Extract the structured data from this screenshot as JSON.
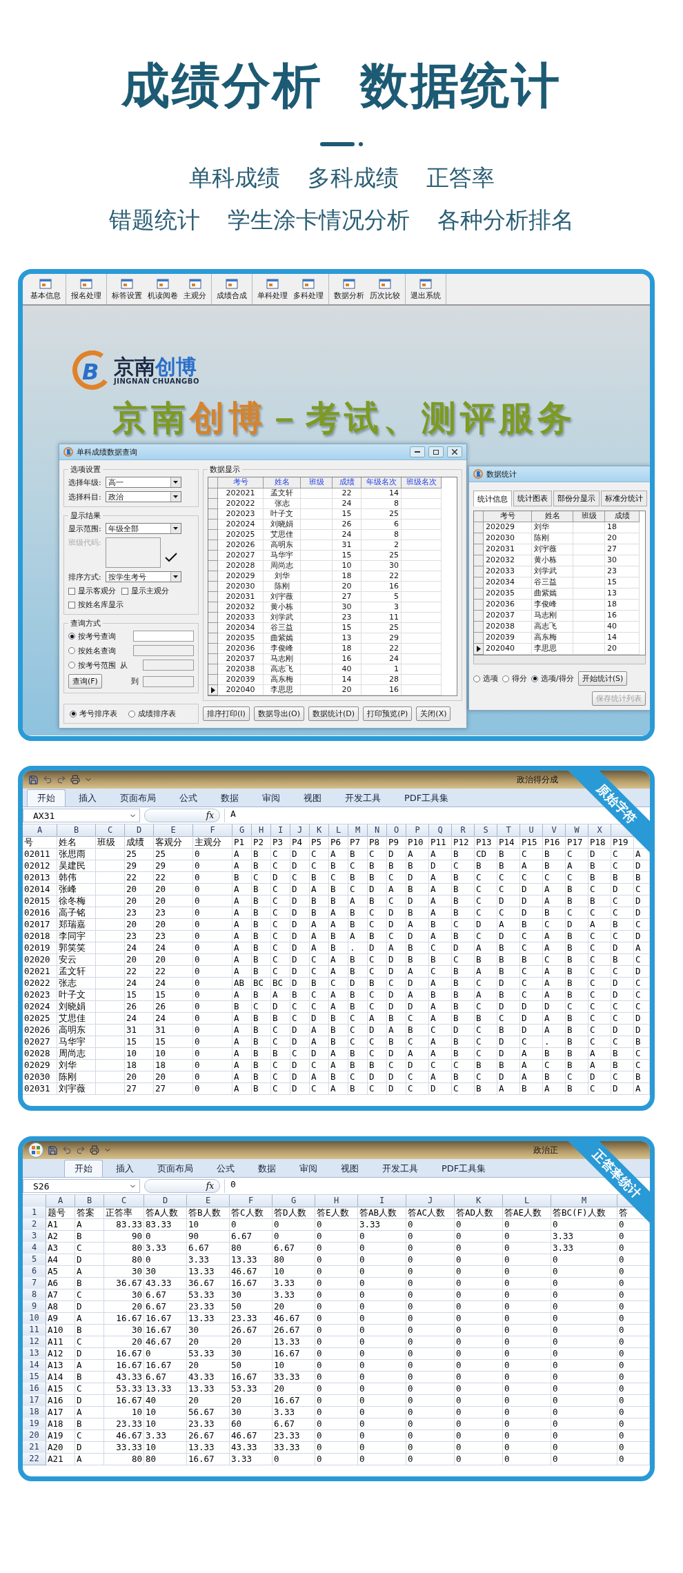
{
  "header": {
    "title": "成绩分析  数据统计",
    "features": [
      [
        "单科成绩",
        "多科成绩",
        "正答率"
      ],
      [
        "错题统计",
        "学生涂卡情况分析",
        "各种分析排名"
      ]
    ]
  },
  "app": {
    "toolbar": [
      [
        "基本信息"
      ],
      [
        "报名处理"
      ],
      [
        "标答设置",
        "机读阅卷",
        "主观分"
      ],
      [
        "成绩合成"
      ],
      [
        "单科处理",
        "多科处理"
      ],
      [
        "数据分析",
        "历次比较"
      ],
      [
        "退出系统"
      ]
    ],
    "logo": {
      "mark": "B",
      "name_a": "京南",
      "name_b": "创博",
      "subtitle": "JINGNAN CHUANGBO"
    },
    "banner": [
      {
        "text": "京南",
        "color": "#7d9a22"
      },
      {
        "text": "创博",
        "color": "#d7832a"
      },
      {
        "text": "－考试、测评服务",
        "color": "#7d9a22"
      }
    ],
    "query_dialog": {
      "title": "单科成绩数据查询",
      "options": {
        "legend": "选项设置",
        "grade": {
          "label": "选择年级:",
          "value": "高一"
        },
        "subject": {
          "label": "选择科目:",
          "value": "政治"
        }
      },
      "display": {
        "legend": "显示结果",
        "range": {
          "label": "显示范围:",
          "value": "年级全部"
        },
        "class_code": {
          "label": "班级代码:",
          "disabled": true
        },
        "sort": {
          "label": "排序方式:",
          "value": "按学生考号"
        },
        "checkboxes": [
          {
            "label": "显示客观分",
            "checked": false
          },
          {
            "label": "显示主观分",
            "checked": false
          },
          {
            "label": "按姓名库显示",
            "checked": false
          }
        ]
      },
      "query": {
        "legend": "查询方式",
        "modes": [
          {
            "label": "按考号查询",
            "selected": true
          },
          {
            "label": "按姓名查询",
            "selected": false
          },
          {
            "label": "按考号范围",
            "selected": false
          }
        ],
        "from_label": "从",
        "to_label": "到",
        "button": "查询(F)"
      },
      "sort_tables": [
        {
          "label": "考号排序表",
          "selected": true
        },
        {
          "label": "成绩排序表",
          "selected": false
        }
      ],
      "buttons": [
        "排序打印(I)",
        "数据导出(O)",
        "数据统计(D)",
        "打印预览(P)",
        "关闭(X)"
      ],
      "grid": {
        "legend": "数据显示",
        "columns": [
          "考号",
          "姓名",
          "班级",
          "成绩",
          "年级名次",
          "班级名次"
        ],
        "rows": [
          {
            "cells": [
              "202021",
              "孟文轩",
              "",
              "22",
              "14",
              ""
            ],
            "current": false
          },
          {
            "cells": [
              "202022",
              "张志",
              "",
              "24",
              "8",
              ""
            ],
            "current": false
          },
          {
            "cells": [
              "202023",
              "叶子文",
              "",
              "15",
              "25",
              ""
            ],
            "current": false
          },
          {
            "cells": [
              "202024",
              "刘晓娟",
              "",
              "26",
              "6",
              ""
            ],
            "current": false
          },
          {
            "cells": [
              "202025",
              "艾思佳",
              "",
              "24",
              "8",
              ""
            ],
            "current": false
          },
          {
            "cells": [
              "202026",
              "高明东",
              "",
              "31",
              "2",
              ""
            ],
            "current": false
          },
          {
            "cells": [
              "202027",
              "马华宇",
              "",
              "15",
              "25",
              ""
            ],
            "current": false
          },
          {
            "cells": [
              "202028",
              "周尚志",
              "",
              "10",
              "30",
              ""
            ],
            "current": false
          },
          {
            "cells": [
              "202029",
              "刘华",
              "",
              "18",
              "22",
              ""
            ],
            "current": false
          },
          {
            "cells": [
              "202030",
              "陈刚",
              "",
              "20",
              "16",
              ""
            ],
            "current": false
          },
          {
            "cells": [
              "202031",
              "刘宇薇",
              "",
              "27",
              "5",
              ""
            ],
            "current": false
          },
          {
            "cells": [
              "202032",
              "黄小栋",
              "",
              "30",
              "3",
              ""
            ],
            "current": false
          },
          {
            "cells": [
              "202033",
              "刘学武",
              "",
              "23",
              "11",
              ""
            ],
            "current": false
          },
          {
            "cells": [
              "202034",
              "谷三益",
              "",
              "15",
              "25",
              ""
            ],
            "current": false
          },
          {
            "cells": [
              "202035",
              "曲紫嫣",
              "",
              "13",
              "29",
              ""
            ],
            "current": false
          },
          {
            "cells": [
              "202036",
              "李俊峰",
              "",
              "18",
              "22",
              ""
            ],
            "current": false
          },
          {
            "cells": [
              "202037",
              "马志刚",
              "",
              "16",
              "24",
              ""
            ],
            "current": false
          },
          {
            "cells": [
              "202038",
              "高志飞",
              "",
              "40",
              "1",
              ""
            ],
            "current": false
          },
          {
            "cells": [
              "202039",
              "高东梅",
              "",
              "14",
              "28",
              ""
            ],
            "current": false
          },
          {
            "cells": [
              "202040",
              "李思思",
              "",
              "20",
              "16",
              ""
            ],
            "current": true
          }
        ]
      }
    },
    "stats_dialog": {
      "title": "数据统计",
      "tabs": [
        {
          "label": "统计信息",
          "selected": true
        },
        {
          "label": "统计图表",
          "selected": false
        },
        {
          "label": "部份分显示",
          "selected": false
        },
        {
          "label": "标准分统计",
          "selected": false
        }
      ],
      "grid": {
        "columns": [
          "考号",
          "姓名",
          "班级",
          "成绩"
        ],
        "rows": [
          {
            "cells": [
              "202029",
              "刘华",
              "",
              "18"
            ],
            "current": false
          },
          {
            "cells": [
              "202030",
              "陈刚",
              "",
              "20"
            ],
            "current": false
          },
          {
            "cells": [
              "202031",
              "刘宇薇",
              "",
              "27"
            ],
            "current": false
          },
          {
            "cells": [
              "202032",
              "黄小栋",
              "",
              "30"
            ],
            "current": false
          },
          {
            "cells": [
              "202033",
              "刘学武",
              "",
              "23"
            ],
            "current": false
          },
          {
            "cells": [
              "202034",
              "谷三益",
              "",
              "15"
            ],
            "current": false
          },
          {
            "cells": [
              "202035",
              "曲紫嫣",
              "",
              "13"
            ],
            "current": false
          },
          {
            "cells": [
              "202036",
              "李俊峰",
              "",
              "18"
            ],
            "current": false
          },
          {
            "cells": [
              "202037",
              "马志刚",
              "",
              "16"
            ],
            "current": false
          },
          {
            "cells": [
              "202038",
              "高志飞",
              "",
              "40"
            ],
            "current": false
          },
          {
            "cells": [
              "202039",
              "高东梅",
              "",
              "14"
            ],
            "current": false
          },
          {
            "cells": [
              "202040",
              "李思思",
              "",
              "20"
            ],
            "current": true
          }
        ]
      },
      "modes": [
        {
          "label": "选项",
          "selected": false
        },
        {
          "label": "得分",
          "selected": false
        },
        {
          "label": "选项/得分",
          "selected": true
        }
      ],
      "start_button": "开始统计(S)",
      "save_button": {
        "label": "保存统计列表",
        "disabled": true
      }
    }
  },
  "sheets": [
    {
      "ribbon": "原始字符",
      "window_title": "政治得分成",
      "office_button": false,
      "tabs": [
        {
          "label": "开始",
          "selected": true
        },
        {
          "label": "插入",
          "selected": false
        },
        {
          "label": "页面布局",
          "selected": false
        },
        {
          "label": "公式",
          "selected": false
        },
        {
          "label": "数据",
          "selected": false
        },
        {
          "label": "审阅",
          "selected": false
        },
        {
          "label": "视图",
          "selected": false
        },
        {
          "label": "开发工具",
          "selected": false
        },
        {
          "label": "PDF工具集",
          "selected": false
        }
      ],
      "name_box": "AX31",
      "function_label": "fx",
      "formula": "A",
      "column_letters": [
        "A",
        "B",
        "C",
        "D",
        "E",
        "F",
        "G",
        "H",
        "I",
        "J",
        "K",
        "L",
        "M",
        "N",
        "O",
        "P",
        "Q",
        "R",
        "S",
        "T",
        "U",
        "V",
        "W",
        "X"
      ],
      "rows": [
        [
          "号",
          "姓名",
          "班级",
          "成绩",
          "客观分",
          "主观分",
          "P1",
          "P2",
          "P3",
          "P4",
          "P5",
          "P6",
          "P7",
          "P8",
          "P9",
          "P10",
          "P11",
          "P12",
          "P13",
          "P14",
          "P15",
          "P16",
          "P17",
          "P18",
          "P19",
          ""
        ],
        [
          "02011",
          "张思雨",
          "",
          "25",
          "25",
          "0",
          "A",
          "B",
          "C",
          "D",
          "C",
          "A",
          "B",
          "C",
          "D",
          "A",
          "A",
          "B",
          "CD",
          "B",
          "C",
          "B",
          "C",
          "D",
          "C",
          "A"
        ],
        [
          "02012",
          "吴建民",
          "",
          "29",
          "29",
          "0",
          "A",
          "B",
          "C",
          "D",
          "C",
          "B",
          "C",
          "B",
          "B",
          "B",
          "D",
          "C",
          "B",
          "B",
          "A",
          "B",
          "A",
          "B",
          "C",
          "D"
        ],
        [
          "02013",
          "韩伟",
          "",
          "22",
          "22",
          "0",
          "B",
          "C",
          "D",
          "C",
          "B",
          "C",
          "B",
          "B",
          "C",
          "D",
          "A",
          "B",
          "C",
          "C",
          "C",
          "C",
          "C",
          "B",
          "B",
          "B"
        ],
        [
          "02014",
          "张峰",
          "",
          "20",
          "20",
          "0",
          "A",
          "B",
          "C",
          "D",
          "A",
          "B",
          "C",
          "D",
          "A",
          "B",
          "A",
          "B",
          "C",
          "C",
          "D",
          "A",
          "B",
          "C",
          "D",
          "C"
        ],
        [
          "02015",
          "徐冬梅",
          "",
          "20",
          "20",
          "0",
          "A",
          "B",
          "C",
          "D",
          "B",
          "B",
          "A",
          "B",
          "C",
          "D",
          "A",
          "B",
          "C",
          "D",
          "D",
          "A",
          "B",
          "B",
          "C",
          "D"
        ],
        [
          "02016",
          "高子铭",
          "",
          "23",
          "23",
          "0",
          "A",
          "B",
          "C",
          "D",
          "B",
          "A",
          "B",
          "C",
          "D",
          "B",
          "A",
          "B",
          "C",
          "C",
          "D",
          "B",
          "C",
          "C",
          "C",
          "D"
        ],
        [
          "02017",
          "郑瑞嘉",
          "",
          "20",
          "20",
          "0",
          "A",
          "B",
          "C",
          "D",
          "A",
          "A",
          "B",
          "C",
          "D",
          "A",
          "B",
          "C",
          "D",
          "A",
          "B",
          "C",
          "D",
          "A",
          "B",
          "C"
        ],
        [
          "02018",
          "李同宇",
          "",
          "23",
          "23",
          "0",
          "A",
          "B",
          "C",
          "D",
          "A",
          "B",
          "A",
          "B",
          "C",
          "D",
          "A",
          "B",
          "C",
          "D",
          "C",
          "A",
          "B",
          "C",
          "C",
          "D"
        ],
        [
          "02019",
          "郭笑笑",
          "",
          "24",
          "24",
          "0",
          "A",
          "B",
          "C",
          "D",
          "A",
          "B",
          ".",
          "D",
          "A",
          "B",
          "C",
          "D",
          "A",
          "B",
          "C",
          "A",
          "B",
          "C",
          "D",
          "A"
        ],
        [
          "02020",
          "安云",
          "",
          "20",
          "20",
          "0",
          "A",
          "B",
          "C",
          "D",
          "C",
          "A",
          "B",
          "C",
          "D",
          "B",
          "B",
          "C",
          "B",
          "B",
          "B",
          "C",
          "B",
          "C",
          "B",
          "C"
        ],
        [
          "02021",
          "孟文轩",
          "",
          "22",
          "22",
          "0",
          "A",
          "B",
          "C",
          "D",
          "C",
          "A",
          "B",
          "C",
          "D",
          "A",
          "C",
          "B",
          "A",
          "B",
          "C",
          "A",
          "B",
          "C",
          "C",
          "D"
        ],
        [
          "02022",
          "张志",
          "",
          "24",
          "24",
          "0",
          "AB",
          "BC",
          "BC",
          "D",
          "B",
          "C",
          "D",
          "B",
          "C",
          "D",
          "A",
          "B",
          "C",
          "D",
          "C",
          "A",
          "B",
          "C",
          "D",
          "C"
        ],
        [
          "02023",
          "叶子文",
          "",
          "15",
          "15",
          "0",
          "A",
          "B",
          "A",
          "B",
          "C",
          "A",
          "B",
          "C",
          "D",
          "A",
          "B",
          "B",
          "A",
          "B",
          "C",
          "A",
          "B",
          "C",
          "D",
          "C"
        ],
        [
          "02024",
          "刘晓娟",
          "",
          "26",
          "26",
          "0",
          "B",
          "C",
          "D",
          "C",
          "C",
          "A",
          "B",
          "C",
          "D",
          "D",
          "A",
          "B",
          "C",
          "D",
          "D",
          "D",
          "C",
          "C",
          "C",
          "C"
        ],
        [
          "02025",
          "艾思佳",
          "",
          "24",
          "24",
          "0",
          "A",
          "B",
          "B",
          "C",
          "D",
          "B",
          "C",
          "A",
          "B",
          "C",
          "A",
          "B",
          "B",
          "C",
          "D",
          "A",
          "B",
          "C",
          "C",
          "D"
        ],
        [
          "02026",
          "高明东",
          "",
          "31",
          "31",
          "0",
          "A",
          "B",
          "C",
          "D",
          "A",
          "B",
          "C",
          "D",
          "A",
          "B",
          "C",
          "D",
          "C",
          "B",
          "D",
          "A",
          "B",
          "C",
          "D",
          "D"
        ],
        [
          "02027",
          "马华宇",
          "",
          "15",
          "15",
          "0",
          "A",
          "B",
          "C",
          "D",
          "A",
          "B",
          "C",
          "C",
          "B",
          "C",
          "A",
          "B",
          "C",
          "D",
          "C",
          ".",
          "B",
          "C",
          "C",
          "B"
        ],
        [
          "02028",
          "周尚志",
          "",
          "10",
          "10",
          "0",
          "A",
          "B",
          "B",
          "C",
          "D",
          "A",
          "B",
          "C",
          "D",
          "A",
          "A",
          "B",
          "C",
          "D",
          "A",
          "B",
          "B",
          "A",
          "B",
          "C"
        ],
        [
          "02029",
          "刘华",
          "",
          "18",
          "18",
          "0",
          "A",
          "B",
          "C",
          "D",
          "C",
          "A",
          "B",
          "B",
          "C",
          "D",
          "C",
          "C",
          "B",
          "B",
          "A",
          "C",
          "B",
          "A",
          "B",
          "C"
        ],
        [
          "02030",
          "陈刚",
          "",
          "20",
          "20",
          "0",
          "A",
          "B",
          "C",
          "D",
          "A",
          "B",
          "C",
          "D",
          "D",
          "C",
          "A",
          "B",
          "C",
          "D",
          "A",
          "B",
          "C",
          "D",
          "C",
          "B"
        ],
        [
          "02031",
          "刘宇薇",
          "",
          "27",
          "27",
          "0",
          "A",
          "B",
          "C",
          "D",
          "C",
          "A",
          "B",
          "C",
          "D",
          "C",
          "D",
          "C",
          "B",
          "A",
          "B",
          "A",
          "B",
          "C",
          "D",
          "A"
        ]
      ]
    },
    {
      "ribbon": "正答率统计",
      "window_title": "政治正",
      "office_button": true,
      "tabs": [
        {
          "label": "开始",
          "selected": true
        },
        {
          "label": "插入",
          "selected": false
        },
        {
          "label": "页面布局",
          "selected": false
        },
        {
          "label": "公式",
          "selected": false
        },
        {
          "label": "数据",
          "selected": false
        },
        {
          "label": "审阅",
          "selected": false
        },
        {
          "label": "视图",
          "selected": false
        },
        {
          "label": "开发工具",
          "selected": false
        },
        {
          "label": "PDF工具集",
          "selected": false
        }
      ],
      "name_box": "S26",
      "function_label": "fx",
      "formula": "0",
      "column_letters": [
        "A",
        "B",
        "C",
        "D",
        "E",
        "F",
        "G",
        "H",
        "I",
        "J",
        "K",
        "L",
        "M"
      ],
      "row_numbers": [
        "1",
        "2",
        "3",
        "4",
        "5",
        "6",
        "7",
        "8",
        "9",
        "10",
        "11",
        "12",
        "13",
        "14",
        "15",
        "16",
        "17",
        "18",
        "19",
        "20",
        "21",
        "22"
      ],
      "rows": [
        [
          "题号",
          "答案",
          "正答率",
          "答A人数",
          "答B人数",
          "答C人数",
          "答D人数",
          "答E人数",
          "答AB人数",
          "答AC人数",
          "答AD人数",
          "答AE人数",
          "答BC(F)人数",
          "答"
        ],
        [
          "A1",
          "A",
          "83.33",
          "83.33",
          "10",
          "0",
          "0",
          "0",
          "3.33",
          "0",
          "0",
          "0",
          "0",
          "0"
        ],
        [
          "A2",
          "B",
          "90",
          "0",
          "90",
          "6.67",
          "0",
          "0",
          "0",
          "0",
          "0",
          "0",
          "3.33",
          "0"
        ],
        [
          "A3",
          "C",
          "80",
          "3.33",
          "6.67",
          "80",
          "6.67",
          "0",
          "0",
          "0",
          "0",
          "0",
          "3.33",
          "0"
        ],
        [
          "A4",
          "D",
          "80",
          "0",
          "3.33",
          "13.33",
          "80",
          "0",
          "0",
          "0",
          "0",
          "0",
          "0",
          "0"
        ],
        [
          "A5",
          "A",
          "30",
          "30",
          "13.33",
          "46.67",
          "10",
          "0",
          "0",
          "0",
          "0",
          "0",
          "0",
          "0"
        ],
        [
          "A6",
          "B",
          "36.67",
          "43.33",
          "36.67",
          "16.67",
          "3.33",
          "0",
          "0",
          "0",
          "0",
          "0",
          "0",
          "0"
        ],
        [
          "A7",
          "C",
          "30",
          "6.67",
          "53.33",
          "30",
          "3.33",
          "0",
          "0",
          "0",
          "0",
          "0",
          "0",
          "0"
        ],
        [
          "A8",
          "D",
          "20",
          "6.67",
          "23.33",
          "50",
          "20",
          "0",
          "0",
          "0",
          "0",
          "0",
          "0",
          "0"
        ],
        [
          "A9",
          "A",
          "16.67",
          "16.67",
          "13.33",
          "23.33",
          "46.67",
          "0",
          "0",
          "0",
          "0",
          "0",
          "0",
          "0"
        ],
        [
          "A10",
          "B",
          "30",
          "16.67",
          "30",
          "26.67",
          "26.67",
          "0",
          "0",
          "0",
          "0",
          "0",
          "0",
          "0"
        ],
        [
          "A11",
          "C",
          "20",
          "46.67",
          "20",
          "20",
          "13.33",
          "0",
          "0",
          "0",
          "0",
          "0",
          "0",
          "0"
        ],
        [
          "A12",
          "D",
          "16.67",
          "0",
          "53.33",
          "30",
          "16.67",
          "0",
          "0",
          "0",
          "0",
          "0",
          "0",
          "0"
        ],
        [
          "A13",
          "A",
          "16.67",
          "16.67",
          "20",
          "50",
          "10",
          "0",
          "0",
          "0",
          "0",
          "0",
          "0",
          "0"
        ],
        [
          "A14",
          "B",
          "43.33",
          "6.67",
          "43.33",
          "16.67",
          "33.33",
          "0",
          "0",
          "0",
          "0",
          "0",
          "0",
          "0"
        ],
        [
          "A15",
          "C",
          "53.33",
          "13.33",
          "13.33",
          "53.33",
          "20",
          "0",
          "0",
          "0",
          "0",
          "0",
          "0",
          "0"
        ],
        [
          "A16",
          "D",
          "16.67",
          "40",
          "20",
          "20",
          "16.67",
          "0",
          "0",
          "0",
          "0",
          "0",
          "0",
          "0"
        ],
        [
          "A17",
          "A",
          "10",
          "10",
          "56.67",
          "30",
          "3.33",
          "0",
          "0",
          "0",
          "0",
          "0",
          "0",
          "0"
        ],
        [
          "A18",
          "B",
          "23.33",
          "10",
          "23.33",
          "60",
          "6.67",
          "0",
          "0",
          "0",
          "0",
          "0",
          "0",
          "0"
        ],
        [
          "A19",
          "C",
          "46.67",
          "3.33",
          "26.67",
          "46.67",
          "23.33",
          "0",
          "0",
          "0",
          "0",
          "0",
          "0",
          "0"
        ],
        [
          "A20",
          "D",
          "33.33",
          "10",
          "13.33",
          "43.33",
          "33.33",
          "0",
          "0",
          "0",
          "0",
          "0",
          "0",
          "0"
        ],
        [
          "A21",
          "A",
          "80",
          "80",
          "16.67",
          "3.33",
          "0",
          "0",
          "0",
          "0",
          "0",
          "0",
          "0",
          "0"
        ]
      ]
    }
  ]
}
